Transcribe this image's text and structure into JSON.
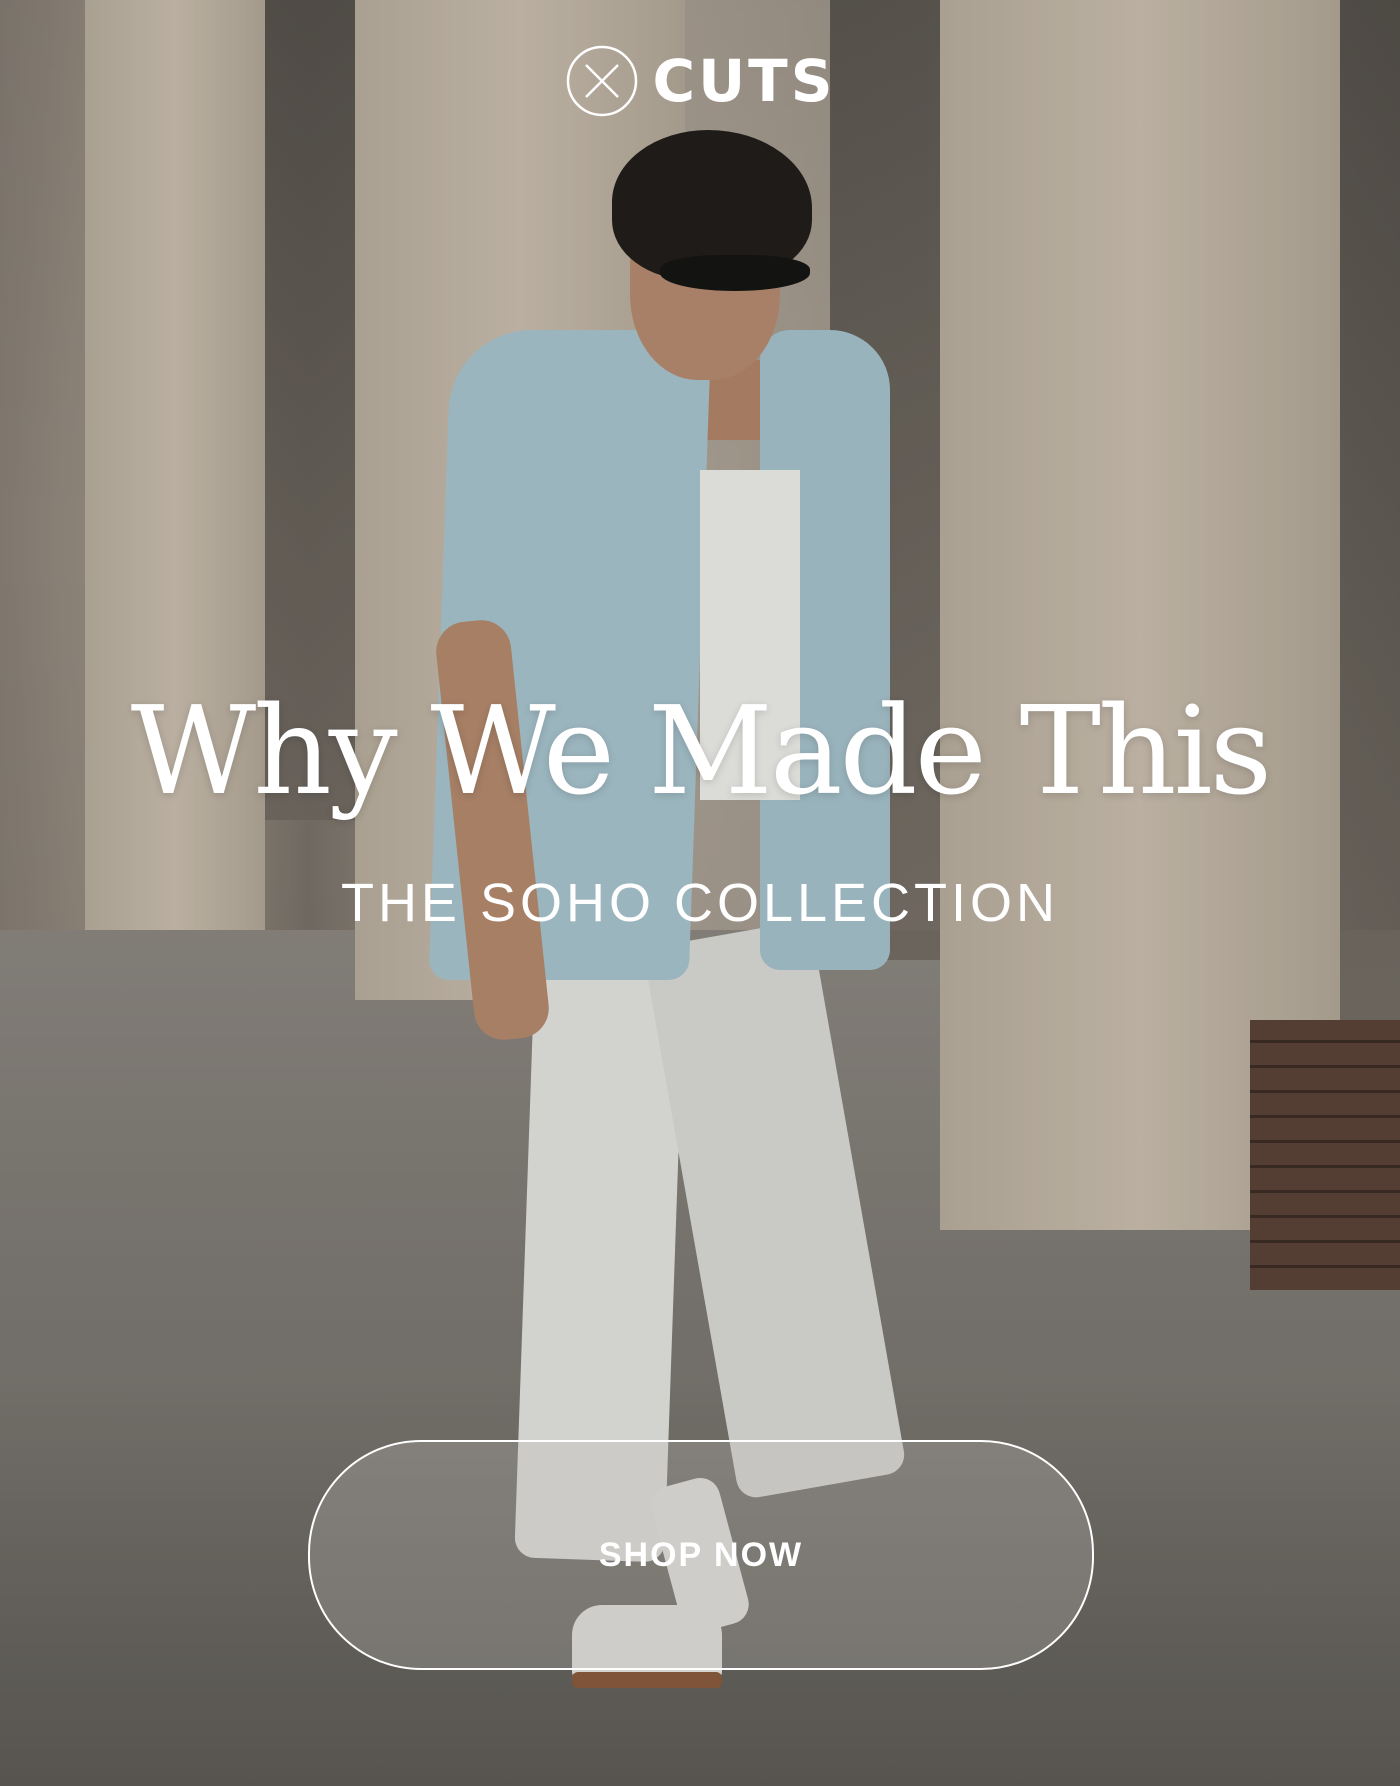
{
  "brand": {
    "name": "CUTS",
    "icon": "x-circle-logo-icon",
    "text_color": "#ffffff"
  },
  "hero": {
    "headline": "Why We Made This",
    "subhead": "THE SOHO COLLECTION",
    "photo_subject": "man-walking-photo",
    "cta_label": "SHOP NOW",
    "cta_border_color": "#ffffff"
  }
}
